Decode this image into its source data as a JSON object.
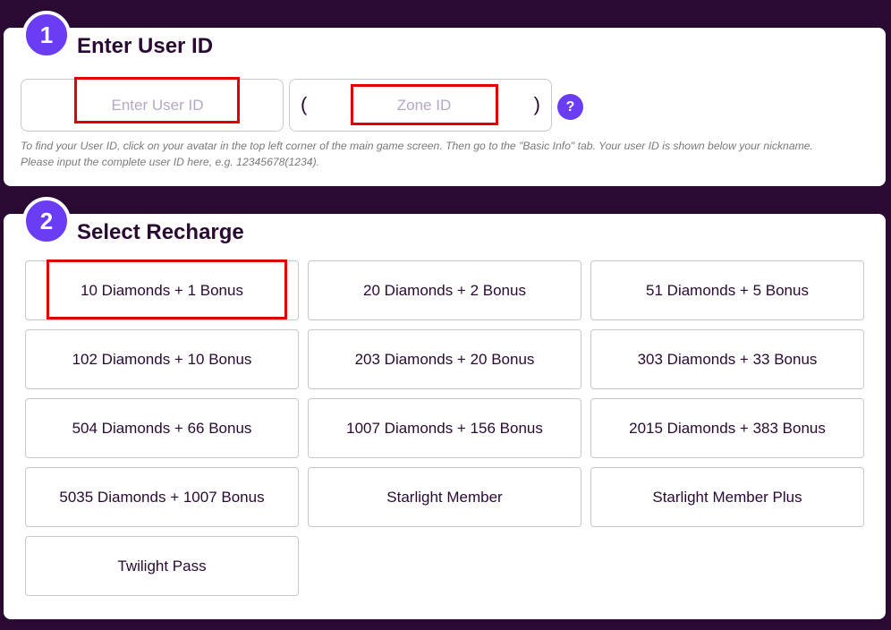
{
  "step1": {
    "number": "1",
    "title": "Enter User ID",
    "userid_placeholder": "Enter User ID",
    "zoneid_placeholder": "Zone ID",
    "paren_open": "(",
    "paren_close": ")",
    "help_label": "?",
    "help_text_line1": "To find your User ID, click on your avatar in the top left corner of the main game screen. Then go to the \"Basic Info\" tab. Your user ID is shown below your nickname.",
    "help_text_line2": "Please input the complete user ID here, e.g. 12345678(1234)."
  },
  "step2": {
    "number": "2",
    "title": "Select Recharge",
    "items": [
      {
        "label": "10 Diamonds + 1 Bonus"
      },
      {
        "label": "20 Diamonds + 2 Bonus"
      },
      {
        "label": "51 Diamonds + 5 Bonus"
      },
      {
        "label": "102 Diamonds + 10 Bonus"
      },
      {
        "label": "203 Diamonds + 20 Bonus"
      },
      {
        "label": "303 Diamonds + 33 Bonus"
      },
      {
        "label": "504 Diamonds + 66 Bonus"
      },
      {
        "label": "1007 Diamonds + 156 Bonus"
      },
      {
        "label": "2015 Diamonds + 383 Bonus"
      },
      {
        "label": "5035 Diamonds + 1007 Bonus"
      },
      {
        "label": "Starlight Member"
      },
      {
        "label": "Starlight Member Plus"
      },
      {
        "label": "Twilight Pass"
      }
    ]
  },
  "colors": {
    "background": "#2a0a33",
    "accent": "#6a3df5",
    "highlight": "#e00000"
  }
}
